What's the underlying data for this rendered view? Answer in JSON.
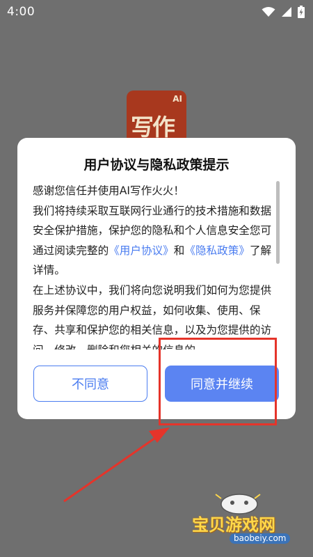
{
  "status_bar": {
    "time": "4:00"
  },
  "app_logo": {
    "text": "写作",
    "badge": "AI"
  },
  "dialog": {
    "title": "用户协议与隐私政策提示",
    "paragraph1_line1": "感谢您信任并使用AI写作火火！",
    "paragraph1_part1": "我们将持续采取互联网行业通行的技术措施和数据安全保护措施，保护您的隐私和个人信息安全您可通过阅读完整的",
    "user_agreement_link": "《用户协议》",
    "and_text": "和",
    "privacy_policy_link": "《隐私政策》",
    "paragraph1_end": "了解详情。",
    "paragraph2": "在上述协议中，我们将向您说明我们如何为您提供服务并保障您的用户权益，如何收集、使用、保存、共享和保护您的相关信息，以及为您提供的访问、修改、删除和您相关的信息的",
    "disagree_button": "不同意",
    "agree_button": "同意并继续"
  },
  "scroll": {
    "thumb_fraction": 0.49
  },
  "watermark": {
    "name": "宝贝游戏网",
    "url": "baobeiy.com"
  },
  "colors": {
    "accent": "#5b84f2",
    "link": "#4a7cf0",
    "annotation": "#e5342a",
    "overlay": "#6f6f6f"
  }
}
